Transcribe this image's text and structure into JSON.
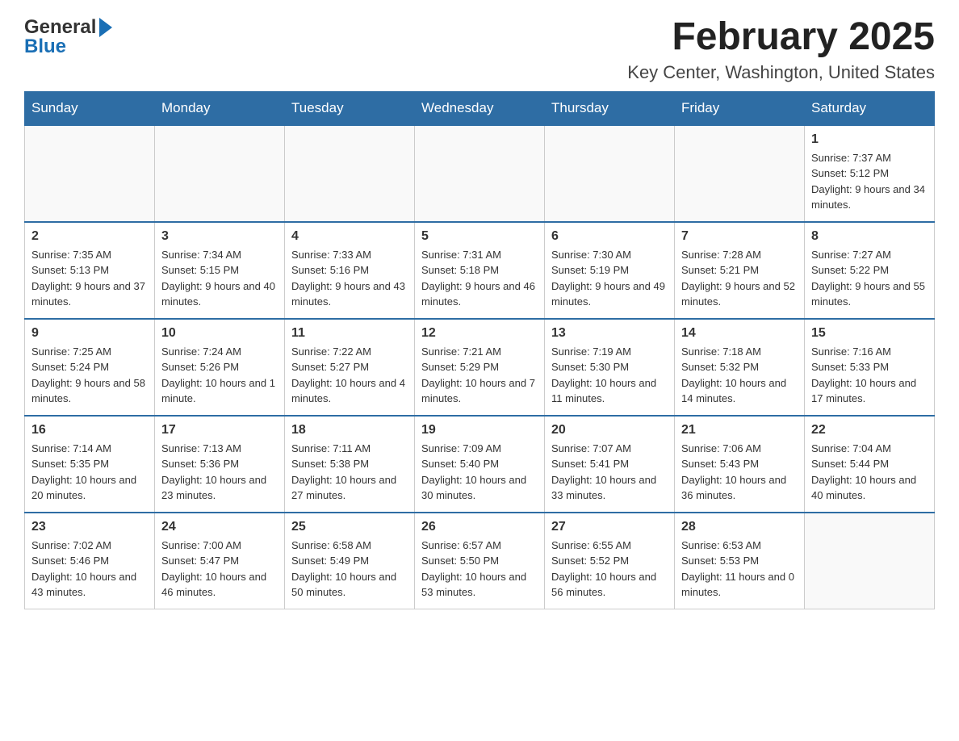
{
  "header": {
    "logo_general": "General",
    "logo_blue": "Blue",
    "month_title": "February 2025",
    "location": "Key Center, Washington, United States"
  },
  "calendar": {
    "days_of_week": [
      "Sunday",
      "Monday",
      "Tuesday",
      "Wednesday",
      "Thursday",
      "Friday",
      "Saturday"
    ],
    "weeks": [
      [
        {
          "day": "",
          "info": ""
        },
        {
          "day": "",
          "info": ""
        },
        {
          "day": "",
          "info": ""
        },
        {
          "day": "",
          "info": ""
        },
        {
          "day": "",
          "info": ""
        },
        {
          "day": "",
          "info": ""
        },
        {
          "day": "1",
          "info": "Sunrise: 7:37 AM\nSunset: 5:12 PM\nDaylight: 9 hours and 34 minutes."
        }
      ],
      [
        {
          "day": "2",
          "info": "Sunrise: 7:35 AM\nSunset: 5:13 PM\nDaylight: 9 hours and 37 minutes."
        },
        {
          "day": "3",
          "info": "Sunrise: 7:34 AM\nSunset: 5:15 PM\nDaylight: 9 hours and 40 minutes."
        },
        {
          "day": "4",
          "info": "Sunrise: 7:33 AM\nSunset: 5:16 PM\nDaylight: 9 hours and 43 minutes."
        },
        {
          "day": "5",
          "info": "Sunrise: 7:31 AM\nSunset: 5:18 PM\nDaylight: 9 hours and 46 minutes."
        },
        {
          "day": "6",
          "info": "Sunrise: 7:30 AM\nSunset: 5:19 PM\nDaylight: 9 hours and 49 minutes."
        },
        {
          "day": "7",
          "info": "Sunrise: 7:28 AM\nSunset: 5:21 PM\nDaylight: 9 hours and 52 minutes."
        },
        {
          "day": "8",
          "info": "Sunrise: 7:27 AM\nSunset: 5:22 PM\nDaylight: 9 hours and 55 minutes."
        }
      ],
      [
        {
          "day": "9",
          "info": "Sunrise: 7:25 AM\nSunset: 5:24 PM\nDaylight: 9 hours and 58 minutes."
        },
        {
          "day": "10",
          "info": "Sunrise: 7:24 AM\nSunset: 5:26 PM\nDaylight: 10 hours and 1 minute."
        },
        {
          "day": "11",
          "info": "Sunrise: 7:22 AM\nSunset: 5:27 PM\nDaylight: 10 hours and 4 minutes."
        },
        {
          "day": "12",
          "info": "Sunrise: 7:21 AM\nSunset: 5:29 PM\nDaylight: 10 hours and 7 minutes."
        },
        {
          "day": "13",
          "info": "Sunrise: 7:19 AM\nSunset: 5:30 PM\nDaylight: 10 hours and 11 minutes."
        },
        {
          "day": "14",
          "info": "Sunrise: 7:18 AM\nSunset: 5:32 PM\nDaylight: 10 hours and 14 minutes."
        },
        {
          "day": "15",
          "info": "Sunrise: 7:16 AM\nSunset: 5:33 PM\nDaylight: 10 hours and 17 minutes."
        }
      ],
      [
        {
          "day": "16",
          "info": "Sunrise: 7:14 AM\nSunset: 5:35 PM\nDaylight: 10 hours and 20 minutes."
        },
        {
          "day": "17",
          "info": "Sunrise: 7:13 AM\nSunset: 5:36 PM\nDaylight: 10 hours and 23 minutes."
        },
        {
          "day": "18",
          "info": "Sunrise: 7:11 AM\nSunset: 5:38 PM\nDaylight: 10 hours and 27 minutes."
        },
        {
          "day": "19",
          "info": "Sunrise: 7:09 AM\nSunset: 5:40 PM\nDaylight: 10 hours and 30 minutes."
        },
        {
          "day": "20",
          "info": "Sunrise: 7:07 AM\nSunset: 5:41 PM\nDaylight: 10 hours and 33 minutes."
        },
        {
          "day": "21",
          "info": "Sunrise: 7:06 AM\nSunset: 5:43 PM\nDaylight: 10 hours and 36 minutes."
        },
        {
          "day": "22",
          "info": "Sunrise: 7:04 AM\nSunset: 5:44 PM\nDaylight: 10 hours and 40 minutes."
        }
      ],
      [
        {
          "day": "23",
          "info": "Sunrise: 7:02 AM\nSunset: 5:46 PM\nDaylight: 10 hours and 43 minutes."
        },
        {
          "day": "24",
          "info": "Sunrise: 7:00 AM\nSunset: 5:47 PM\nDaylight: 10 hours and 46 minutes."
        },
        {
          "day": "25",
          "info": "Sunrise: 6:58 AM\nSunset: 5:49 PM\nDaylight: 10 hours and 50 minutes."
        },
        {
          "day": "26",
          "info": "Sunrise: 6:57 AM\nSunset: 5:50 PM\nDaylight: 10 hours and 53 minutes."
        },
        {
          "day": "27",
          "info": "Sunrise: 6:55 AM\nSunset: 5:52 PM\nDaylight: 10 hours and 56 minutes."
        },
        {
          "day": "28",
          "info": "Sunrise: 6:53 AM\nSunset: 5:53 PM\nDaylight: 11 hours and 0 minutes."
        },
        {
          "day": "",
          "info": ""
        }
      ]
    ]
  }
}
